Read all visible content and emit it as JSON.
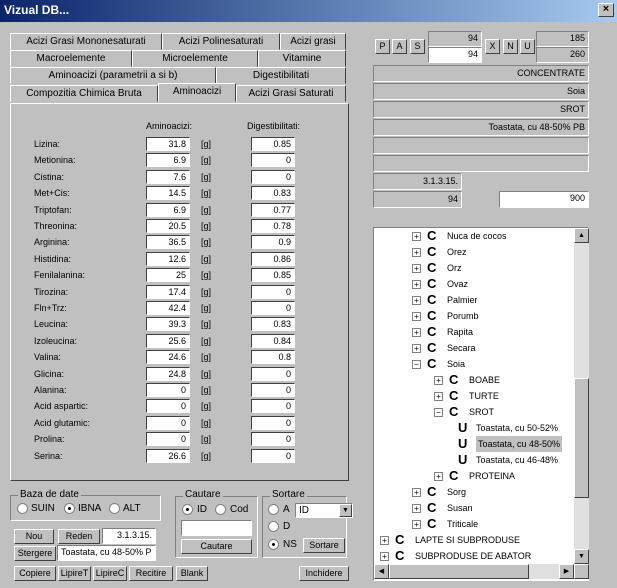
{
  "window": {
    "title": "Vizual DB...",
    "close": "×"
  },
  "tabs": {
    "row1": [
      "Acizi Grasi Mononesaturati",
      "Acizi Polinesaturati",
      "Acizi grasi"
    ],
    "row2": [
      "Macroelemente",
      "Microelemente",
      "Vitamine"
    ],
    "row3": [
      "Aminoacizi (parametrii a si b)",
      "Digestibilitati"
    ],
    "row4": [
      "Compozitia Chimica Bruta",
      "Aminoacizi",
      "Acizi Grasi Saturati"
    ]
  },
  "table": {
    "col1_header": "Aminoacizi:",
    "col2_header": "Digestibilitati:",
    "unit": "[g]",
    "rows": [
      {
        "name": "Lizina:",
        "a": "31.8",
        "d": "0.85"
      },
      {
        "name": "Metionina:",
        "a": "6.9",
        "d": "0"
      },
      {
        "name": "Cistina:",
        "a": "7.6",
        "d": "0"
      },
      {
        "name": "Met+Cis:",
        "a": "14.5",
        "d": "0.83"
      },
      {
        "name": "Triptofan:",
        "a": "6.9",
        "d": "0.77"
      },
      {
        "name": "Threonina:",
        "a": "20.5",
        "d": "0.78"
      },
      {
        "name": "Arginina:",
        "a": "36.5",
        "d": "0.9"
      },
      {
        "name": "Histidina:",
        "a": "12.6",
        "d": "0.86"
      },
      {
        "name": "Fenilalanina:",
        "a": "25",
        "d": "0.85"
      },
      {
        "name": "Tirozina:",
        "a": "17.4",
        "d": "0"
      },
      {
        "name": "Fln+Trz:",
        "a": "42.4",
        "d": "0"
      },
      {
        "name": "Leucina:",
        "a": "39.3",
        "d": "0.83"
      },
      {
        "name": "Izoleucina:",
        "a": "25.6",
        "d": "0.84"
      },
      {
        "name": "Valina:",
        "a": "24.6",
        "d": "0.8"
      },
      {
        "name": "Glicina:",
        "a": "24.8",
        "d": "0"
      },
      {
        "name": "Alanina:",
        "a": "0",
        "d": "0"
      },
      {
        "name": "Acid aspartic:",
        "a": "0",
        "d": "0"
      },
      {
        "name": "Acid glutamic:",
        "a": "0",
        "d": "0"
      },
      {
        "name": "Prolina:",
        "a": "0",
        "d": "0"
      },
      {
        "name": "Serina:",
        "a": "26.6",
        "d": "0"
      }
    ]
  },
  "baza": {
    "title": "Baza de date",
    "opt1": "SUIN",
    "opt2": "IBNA",
    "opt3": "ALT",
    "selected": "IBNA"
  },
  "cautare": {
    "title": "Cautare",
    "opt1": "ID",
    "opt2": "Cod",
    "input": "",
    "button": "Cautare"
  },
  "sortare": {
    "title": "Sortare",
    "optA": "A",
    "optD": "D",
    "optNS": "NS",
    "select": "ID",
    "button": "Sortare"
  },
  "buttons": {
    "nou": "Nou",
    "reden": "Reden",
    "stergere": "Stergere",
    "copiere": "Copiere",
    "lipireT": "LipireT",
    "lipireC": "LipireC",
    "recitire": "Recitire",
    "blank": "Blank",
    "inchidere": "Inchidere"
  },
  "info": {
    "date": "3.1.3.15.",
    "name": "Toastata, cu 48-50% P"
  },
  "nav": {
    "p": "P",
    "a": "A",
    "s": "S",
    "x": "X",
    "n": "N",
    "u": "U",
    "top1": "94",
    "top2": "94",
    "right1": "185",
    "right2": "260"
  },
  "rightfields": {
    "f1": "CONCENTRATE",
    "f2": "Soia",
    "f3": "SROT",
    "f4": "Toastata, cu 48-50% PB",
    "f5": "",
    "f6": "",
    "f7": "3.1.3.15.",
    "f8": "94",
    "f9": "900"
  },
  "tree": [
    {
      "level": 1,
      "pm": "+",
      "icon": "C",
      "label": "Nuca de cocos"
    },
    {
      "level": 1,
      "pm": "+",
      "icon": "C",
      "label": "Orez"
    },
    {
      "level": 1,
      "pm": "+",
      "icon": "C",
      "label": "Orz"
    },
    {
      "level": 1,
      "pm": "+",
      "icon": "C",
      "label": "Ovaz"
    },
    {
      "level": 1,
      "pm": "+",
      "icon": "C",
      "label": "Palmier"
    },
    {
      "level": 1,
      "pm": "+",
      "icon": "C",
      "label": "Porumb"
    },
    {
      "level": 1,
      "pm": "+",
      "icon": "C",
      "label": "Rapita"
    },
    {
      "level": 1,
      "pm": "+",
      "icon": "C",
      "label": "Secara"
    },
    {
      "level": 1,
      "pm": "-",
      "icon": "C",
      "label": "Soia"
    },
    {
      "level": 2,
      "pm": "+",
      "icon": "C",
      "label": "BOABE"
    },
    {
      "level": 2,
      "pm": "+",
      "icon": "C",
      "label": "TURTE"
    },
    {
      "level": 2,
      "pm": "-",
      "icon": "C",
      "label": "SROT"
    },
    {
      "level": 3,
      "pm": "",
      "icon": "U",
      "label": "Toastata, cu 50-52%"
    },
    {
      "level": 3,
      "pm": "",
      "icon": "U",
      "label": "Toastata, cu 48-50%"
    },
    {
      "level": 3,
      "pm": "",
      "icon": "U",
      "label": "Toastata, cu 46-48%"
    },
    {
      "level": 2,
      "pm": "+",
      "icon": "C",
      "label": "PROTEINA"
    },
    {
      "level": 1,
      "pm": "+",
      "icon": "C",
      "label": "Sorg"
    },
    {
      "level": 1,
      "pm": "+",
      "icon": "C",
      "label": "Susan"
    },
    {
      "level": 1,
      "pm": "+",
      "icon": "C",
      "label": "Triticale"
    },
    {
      "level": 0,
      "pm": "+",
      "icon": "C",
      "label": "LAPTE SI SUBPRODUSE"
    },
    {
      "level": 0,
      "pm": "+",
      "icon": "C",
      "label": "SUBPRODUSE DE ABATOR"
    }
  ]
}
